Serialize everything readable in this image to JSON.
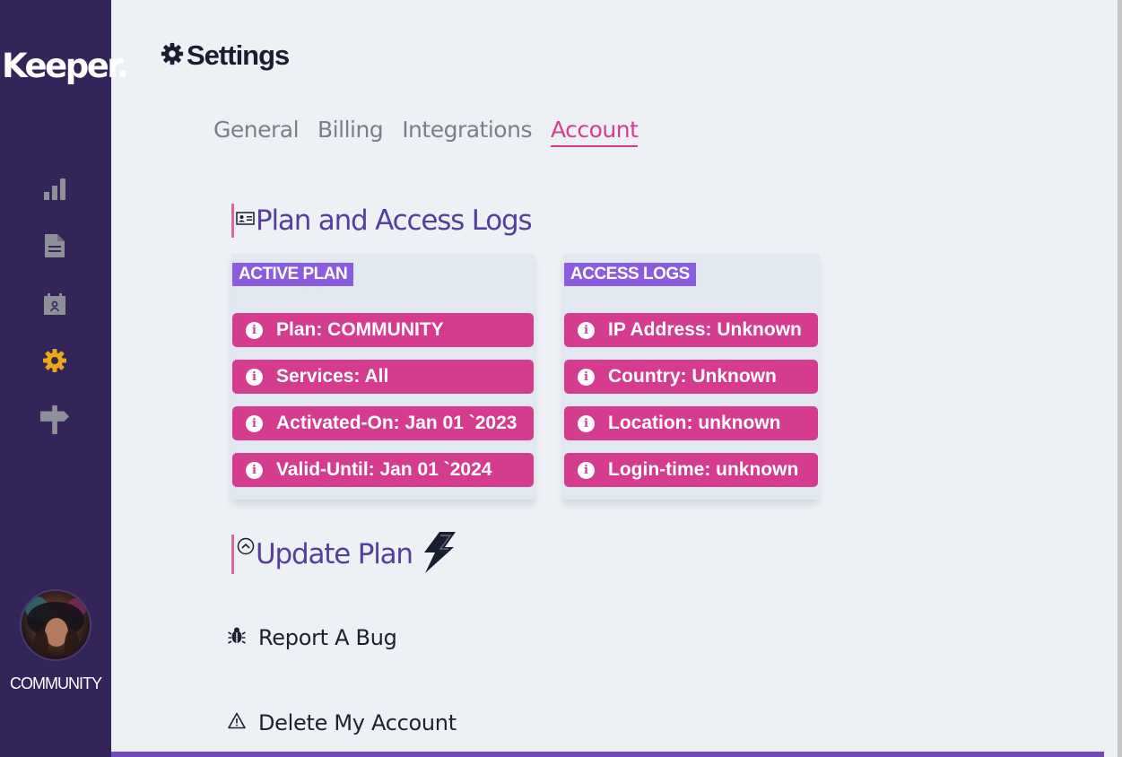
{
  "app": {
    "logo": "Keeper."
  },
  "sidebar": {
    "nav": [
      {
        "name": "dashboard",
        "icon": "bar-chart-icon",
        "active": false
      },
      {
        "name": "documents",
        "icon": "document-icon",
        "active": false
      },
      {
        "name": "contacts",
        "icon": "calendar-person-icon",
        "active": false
      },
      {
        "name": "settings",
        "icon": "gear-icon",
        "active": true
      },
      {
        "name": "signpost",
        "icon": "signpost-icon",
        "active": false
      }
    ],
    "user_plan": "COMMUNITY"
  },
  "header": {
    "title": "Settings",
    "icon": "gear-icon"
  },
  "tabs": [
    {
      "label": "General",
      "active": false
    },
    {
      "label": "Billing",
      "active": false
    },
    {
      "label": "Integrations",
      "active": false
    },
    {
      "label": "Account",
      "active": true
    }
  ],
  "plan_section": {
    "title": "Plan and Access Logs",
    "icon": "id-card-icon",
    "active_plan": {
      "badge": "ACTIVE PLAN",
      "items": [
        "Plan: COMMUNITY",
        "Services: All",
        "Activated-On: Jan 01 `2023",
        "Valid-Until: Jan 01 `2024"
      ]
    },
    "access_logs": {
      "badge": "ACCESS LOGS",
      "items": [
        "IP Address: Unknown",
        "Country: Unknown",
        "Location: unknown",
        "Login-time: unknown"
      ]
    }
  },
  "update_plan": {
    "title": "Update Plan",
    "icon": "chevron-up-circle-icon",
    "accent_icon": "lightning-icon"
  },
  "actions": {
    "report_bug": "Report A Bug",
    "delete_account": "Delete My Account"
  },
  "colors": {
    "sidebar": "#33245a",
    "accent_pink": "#d63c8e",
    "badge_purple": "#8b5ce0",
    "heading_purple": "#563e9c",
    "active_nav": "#e9a815"
  }
}
